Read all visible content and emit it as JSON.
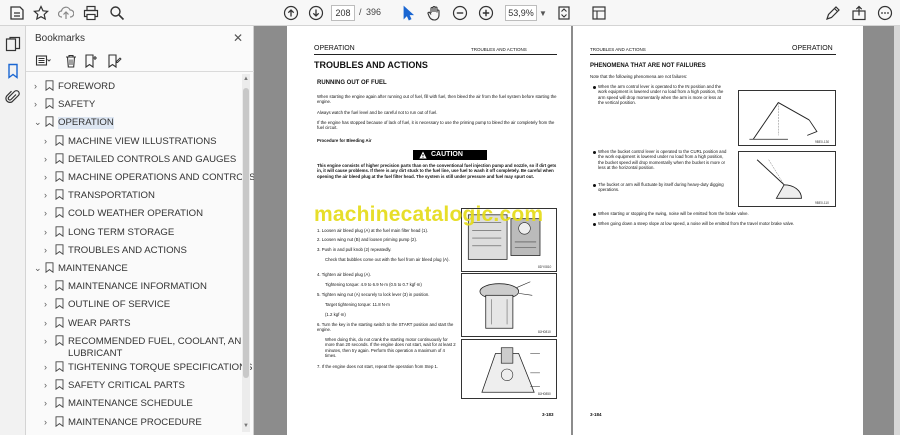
{
  "toolbar": {
    "page_current": "208",
    "page_separator": "/",
    "page_total": "396",
    "zoom": "53,9%"
  },
  "bookmarks_panel": {
    "title": "Bookmarks",
    "close": "✕",
    "items": [
      {
        "label": "FOREWORD",
        "chev": "›",
        "level": 0
      },
      {
        "label": "SAFETY",
        "chev": "›",
        "level": 0
      },
      {
        "label": "OPERATION",
        "chev": "⌄",
        "level": 0,
        "selected": true
      },
      {
        "label": "MACHINE VIEW ILLUSTRATIONS",
        "chev": "›",
        "level": 1
      },
      {
        "label": "DETAILED CONTROLS AND GAUGES",
        "chev": "›",
        "level": 1
      },
      {
        "label": "MACHINE OPERATIONS AND CONTROLS",
        "chev": "›",
        "level": 1
      },
      {
        "label": "TRANSPORTATION",
        "chev": "›",
        "level": 1
      },
      {
        "label": "COLD WEATHER OPERATION",
        "chev": "›",
        "level": 1
      },
      {
        "label": "LONG TERM STORAGE",
        "chev": "›",
        "level": 1
      },
      {
        "label": "TROUBLES AND ACTIONS",
        "chev": "›",
        "level": 1
      },
      {
        "label": "MAINTENANCE",
        "chev": "⌄",
        "level": 0
      },
      {
        "label": "MAINTENANCE INFORMATION",
        "chev": "›",
        "level": 1
      },
      {
        "label": "OUTLINE OF SERVICE",
        "chev": "›",
        "level": 1
      },
      {
        "label": "WEAR PARTS",
        "chev": "›",
        "level": 1
      },
      {
        "label": "RECOMMENDED FUEL, COOLANT, AND",
        "label2": "LUBRICANT",
        "chev": "›",
        "level": 1
      },
      {
        "label": "TIGHTENING TORQUE SPECIFICATIONS",
        "chev": "›",
        "level": 1
      },
      {
        "label": "SAFETY CRITICAL PARTS",
        "chev": "›",
        "level": 1
      },
      {
        "label": "MAINTENANCE SCHEDULE",
        "chev": "›",
        "level": 1
      },
      {
        "label": "MAINTENANCE PROCEDURE",
        "chev": "›",
        "level": 1
      }
    ]
  },
  "left_page": {
    "header_left": "OPERATION",
    "header_right": "TROUBLES AND ACTIONS",
    "title": "TROUBLES AND ACTIONS",
    "subtitle": "RUNNING OUT OF FUEL",
    "p1": "When starting the engine again after running out of fuel, fill with fuel, then bleed the air from the fuel system before starting the engine.",
    "p2": "Always watch the fuel level and be careful not to run out of fuel.",
    "p3": "If the engine has stopped because of lack of fuel, it is necessary to use the priming pump to bleed the air completely from the fuel circuit.",
    "procedure": "Procedure for Bleeding Air",
    "caution": "CAUTION",
    "caution_text": "This engine consists of higher precision parts than on the conventional fuel injection pump and nozzle, so if dirt gets in, it will cause problems. If there is any dirt stuck to the fuel line, use fuel to wash it off completely. Be careful when opening the air bleed plug at the fuel filter head. The system is still under pressure and fuel may spurt out.",
    "step1": "1.  Loosen air bleed plug (A) at the fuel main filter head (1).",
    "step2": "2.  Loosen wing nut (B) and loosen priming pump (2).",
    "step3": "3.  Push in and pull knob (2) repeatedly.",
    "step3b": "Check that bubbles come out with the fuel from air bleed plug (A).",
    "step4": "4.  Tighten air bleed plug (A).",
    "step4b": "Tightening torque: 4.9 to 6.9 N·m (0.5 to 0.7 kgf·m)",
    "step5": "5.  Tighten wing nut (A) securely to lock lever (3) in position.",
    "step5b": "Target tightening torque: 11.8 N·m",
    "step5c": "(1.2 kgf·m)",
    "step6": "6.  Turn the key in the starting switch to the START position and start the engine.",
    "step6b": "When doing this, do not crank the starting motor continuously for more than 20 seconds. If the engine does not start, wait for at least 2 minutes, then try again. Perform this operation a maximum of 4 times.",
    "step7": "7.  If the engine does not start, repeat the operation from Step 1.",
    "page_number": "3-183",
    "fig1_caption": "8DY0810",
    "fig2_caption": "8JH0810",
    "fig3_caption": "8JH0850",
    "watermark": "machinecatalogic.com"
  },
  "right_page": {
    "header_left": "TROUBLES AND ACTIONS",
    "header_right": "OPERATION",
    "title": "PHENOMENA THAT ARE NOT FAILURES",
    "intro": "Note that the following phenomena are not failures:",
    "b1": "When the arm control lever is operated to the IN position and the work equipment is lowered under no load from a high position, the arm speed will drop momentarily when the arm is more or less at the vertical position.",
    "b2": "When the bucket control lever is operated to the CURL position and the work equipment is lowered under no load from a high position, the bucket speed will drop momentarily when the bucket is more or less at the horizontal position.",
    "b3": "The bucket or arm will fluctuate by itself during heavy-duty digging operations.",
    "b4": "When starting or stopping the swing, noise will be emitted from the brake valve.",
    "b5": "When going down a steep slope at low speed, a noise will be emitted from the travel motor brake valve.",
    "fig1_caption": "9BE0-130",
    "fig2_caption": "9BE0-110",
    "page_number": "3-184"
  },
  "colors": {
    "watermark": "#e5dc18",
    "caution_bg": "#000000",
    "selected_bg": "#dde6f2"
  }
}
